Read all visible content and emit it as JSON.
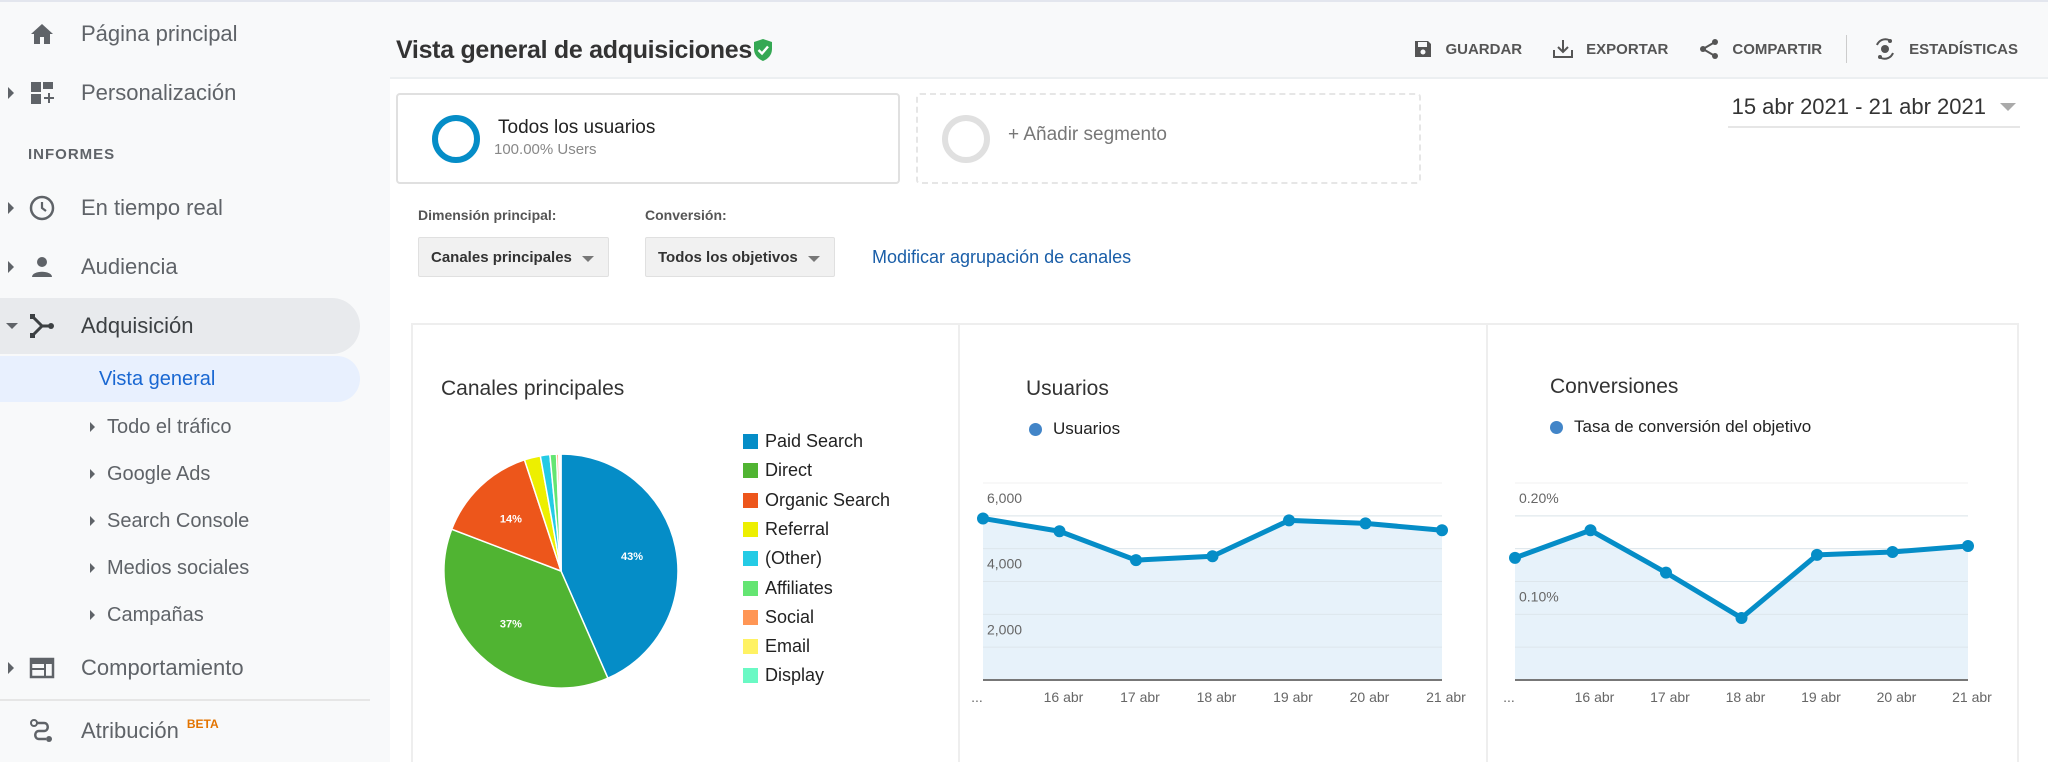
{
  "sidebar": {
    "items": [
      {
        "label": "Página principal",
        "icon": "home-icon"
      },
      {
        "label": "Personalización",
        "icon": "dashboard-add-icon"
      },
      {
        "label": "En tiempo real",
        "icon": "clock-icon"
      },
      {
        "label": "Audiencia",
        "icon": "person-icon"
      },
      {
        "label": "Adquisición",
        "icon": "acquisition-icon"
      },
      {
        "label": "Comportamiento",
        "icon": "behavior-icon"
      },
      {
        "label": "Atribución",
        "icon": "attribution-icon",
        "badge": "BETA"
      }
    ],
    "section_label": "INFORMES",
    "sub_items": [
      {
        "label": "Vista general"
      },
      {
        "label": "Todo el tráfico"
      },
      {
        "label": "Google Ads"
      },
      {
        "label": "Search Console"
      },
      {
        "label": "Medios sociales"
      },
      {
        "label": "Campañas"
      }
    ]
  },
  "header": {
    "title": "Vista general de adquisiciones",
    "verified_icon": "shield-check-icon",
    "toolbar": {
      "save": "GUARDAR",
      "export": "EXPORTAR",
      "share": "COMPARTIR",
      "insights": "ESTADÍSTICAS"
    }
  },
  "segments": {
    "active": {
      "name": "Todos los usuarios",
      "sub": "100.00% Users"
    },
    "add": "+ Añadir segmento"
  },
  "date_range": "15 abr 2021 - 21 abr 2021",
  "controls": {
    "dimension_label": "Dimensión principal:",
    "dimension_value": "Canales principales",
    "conversion_label": "Conversión:",
    "conversion_value": "Todos los objetivos",
    "modify_link": "Modificar agrupación de canales"
  },
  "colors": {
    "accent": "#058dc7",
    "link": "#1a5ea8",
    "verified": "#34a853",
    "beta": "#e37400"
  },
  "chart_data": [
    {
      "type": "pie",
      "title": "Canales principales",
      "categories": [
        "Paid Search",
        "Direct",
        "Organic Search",
        "Referral",
        "(Other)",
        "Affiliates",
        "Social",
        "Email",
        "Display"
      ],
      "values": [
        43,
        37,
        14,
        2.2,
        1.3,
        0.9,
        0.3,
        0.2,
        0.1
      ],
      "colors": [
        "#058dc7",
        "#50b432",
        "#ed561b",
        "#edef00",
        "#24cbe5",
        "#64e572",
        "#ff9655",
        "#fff263",
        "#6af9c4"
      ],
      "data_labels": [
        "43%",
        "37%",
        "14%",
        "",
        "",
        "",
        "",
        "",
        ""
      ],
      "legend_position": "right"
    },
    {
      "type": "area",
      "title": "Usuarios",
      "series": [
        {
          "name": "Usuarios",
          "values": [
            4920,
            4530,
            3650,
            3770,
            4860,
            4770,
            4560
          ]
        }
      ],
      "x": [
        "...",
        "16 abr",
        "17 abr",
        "18 abr",
        "19 abr",
        "20 abr",
        "21 abr"
      ],
      "yticks": [
        2000,
        4000,
        6000
      ],
      "ytick_labels": [
        "2,000",
        "4,000",
        "6,000"
      ],
      "ylim": [
        0,
        6000
      ],
      "grid": true,
      "legend_position": "top-left"
    },
    {
      "type": "area",
      "title": "Conversiones",
      "series": [
        {
          "name": "Tasa de conversión del objetivo",
          "values": [
            0.124,
            0.152,
            0.109,
            0.063,
            0.127,
            0.13,
            0.136
          ]
        }
      ],
      "x": [
        "...",
        "16 abr",
        "17 abr",
        "18 abr",
        "19 abr",
        "20 abr",
        "21 abr"
      ],
      "yticks": [
        0.1,
        0.2
      ],
      "ytick_labels": [
        "0.10%",
        "0.20%"
      ],
      "ylim": [
        0,
        0.2
      ],
      "grid": true,
      "legend_position": "top-left"
    }
  ]
}
